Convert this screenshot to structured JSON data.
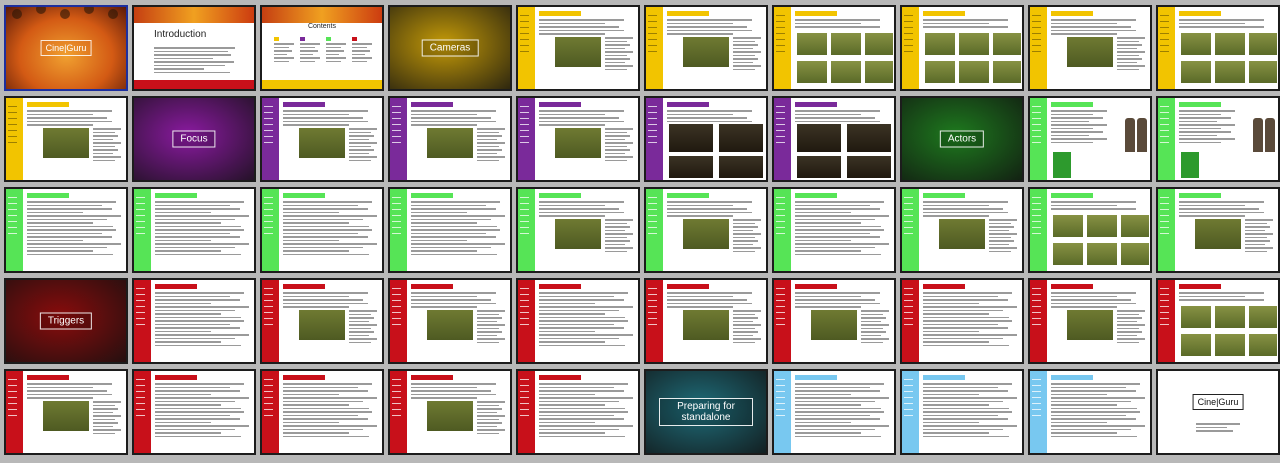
{
  "slides": [
    {
      "kind": "title",
      "logo": "Cine|Guru",
      "bg": "#d35a14"
    },
    {
      "kind": "intro",
      "title": "Introduction"
    },
    {
      "kind": "contents",
      "title": "Contents"
    },
    {
      "kind": "section",
      "title": "Cameras",
      "bg": "#c49a08"
    },
    {
      "kind": "page",
      "strip": "#f2c400",
      "layout": "pic"
    },
    {
      "kind": "page",
      "strip": "#f2c400",
      "layout": "pic"
    },
    {
      "kind": "page",
      "strip": "#f2c400",
      "layout": "grid"
    },
    {
      "kind": "page",
      "strip": "#f2c400",
      "layout": "grid"
    },
    {
      "kind": "page",
      "strip": "#f2c400",
      "layout": "pic"
    },
    {
      "kind": "page",
      "strip": "#f2c400",
      "layout": "grid"
    },
    {
      "kind": "page",
      "strip": "#f2c400",
      "layout": "pic"
    },
    {
      "kind": "section",
      "title": "Focus",
      "bg": "#8a1aa0"
    },
    {
      "kind": "page",
      "strip": "#7a2a9a",
      "layout": "pic"
    },
    {
      "kind": "page",
      "strip": "#7a2a9a",
      "layout": "pic"
    },
    {
      "kind": "page",
      "strip": "#7a2a9a",
      "layout": "pic"
    },
    {
      "kind": "page",
      "strip": "#7a2a9a",
      "layout": "dark"
    },
    {
      "kind": "page",
      "strip": "#7a2a9a",
      "layout": "dark"
    },
    {
      "kind": "section",
      "title": "Actors",
      "bg": "#1e7a1e"
    },
    {
      "kind": "page",
      "strip": "#56e456",
      "layout": "person"
    },
    {
      "kind": "page",
      "strip": "#56e456",
      "layout": "person"
    },
    {
      "kind": "page",
      "strip": "#56e456",
      "layout": "text"
    },
    {
      "kind": "page",
      "strip": "#56e456",
      "layout": "text"
    },
    {
      "kind": "page",
      "strip": "#56e456",
      "layout": "text"
    },
    {
      "kind": "page",
      "strip": "#56e456",
      "layout": "text"
    },
    {
      "kind": "page",
      "strip": "#56e456",
      "layout": "pic"
    },
    {
      "kind": "page",
      "strip": "#56e456",
      "layout": "pic"
    },
    {
      "kind": "page",
      "strip": "#56e456",
      "layout": "text"
    },
    {
      "kind": "page",
      "strip": "#56e456",
      "layout": "pic"
    },
    {
      "kind": "page",
      "strip": "#56e456",
      "layout": "grid"
    },
    {
      "kind": "page",
      "strip": "#56e456",
      "layout": "pic"
    },
    {
      "kind": "section",
      "title": "Triggers",
      "bg": "#8a0c0c"
    },
    {
      "kind": "page",
      "strip": "#c8101a",
      "layout": "text"
    },
    {
      "kind": "page",
      "strip": "#c8101a",
      "layout": "pic"
    },
    {
      "kind": "page",
      "strip": "#c8101a",
      "layout": "pic"
    },
    {
      "kind": "page",
      "strip": "#c8101a",
      "layout": "text"
    },
    {
      "kind": "page",
      "strip": "#c8101a",
      "layout": "pic"
    },
    {
      "kind": "page",
      "strip": "#c8101a",
      "layout": "pic"
    },
    {
      "kind": "page",
      "strip": "#c8101a",
      "layout": "text"
    },
    {
      "kind": "page",
      "strip": "#c8101a",
      "layout": "pic"
    },
    {
      "kind": "page",
      "strip": "#c8101a",
      "layout": "grid"
    },
    {
      "kind": "page",
      "strip": "#c8101a",
      "layout": "pic"
    },
    {
      "kind": "page",
      "strip": "#c8101a",
      "layout": "text"
    },
    {
      "kind": "page",
      "strip": "#c8101a",
      "layout": "text"
    },
    {
      "kind": "page",
      "strip": "#c8101a",
      "layout": "pic"
    },
    {
      "kind": "page",
      "strip": "#c8101a",
      "layout": "text"
    },
    {
      "kind": "section",
      "title": "Preparing for standalone",
      "bg": "#1f6d7a",
      "multi": true
    },
    {
      "kind": "page",
      "strip": "#78c8f0",
      "layout": "text"
    },
    {
      "kind": "page",
      "strip": "#78c8f0",
      "layout": "text"
    },
    {
      "kind": "page",
      "strip": "#78c8f0",
      "layout": "text"
    },
    {
      "kind": "end",
      "logo": "Cine|Guru"
    }
  ]
}
